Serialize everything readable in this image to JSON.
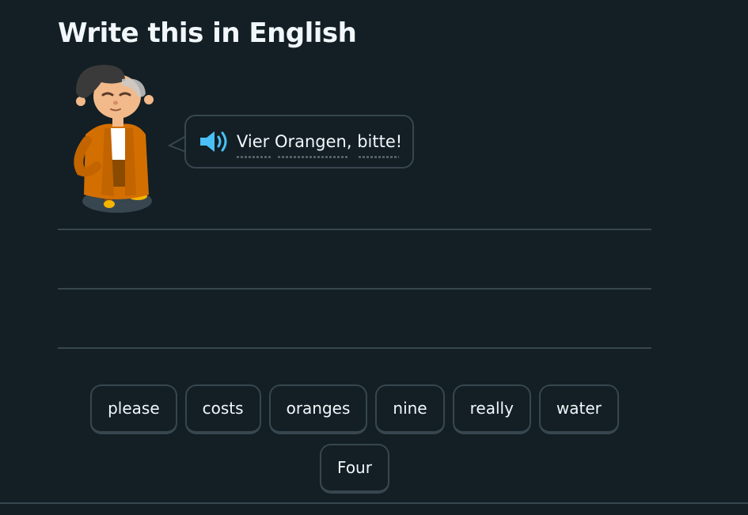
{
  "page": {
    "title": "Write this in English"
  },
  "prompt": {
    "speaker_icon": "speaker-icon",
    "text": "Vier Orangen, bitte!"
  },
  "character": {
    "icon": "character-illustration"
  },
  "word_bank": {
    "words": [
      "please",
      "costs",
      "oranges",
      "nine",
      "really",
      "water",
      "Four"
    ]
  },
  "colors": {
    "background": "#131f24",
    "border": "#37464f",
    "text": "#f1f7fb",
    "speaker_blue": "#49c0f8",
    "character_orange": "#d36f00"
  }
}
